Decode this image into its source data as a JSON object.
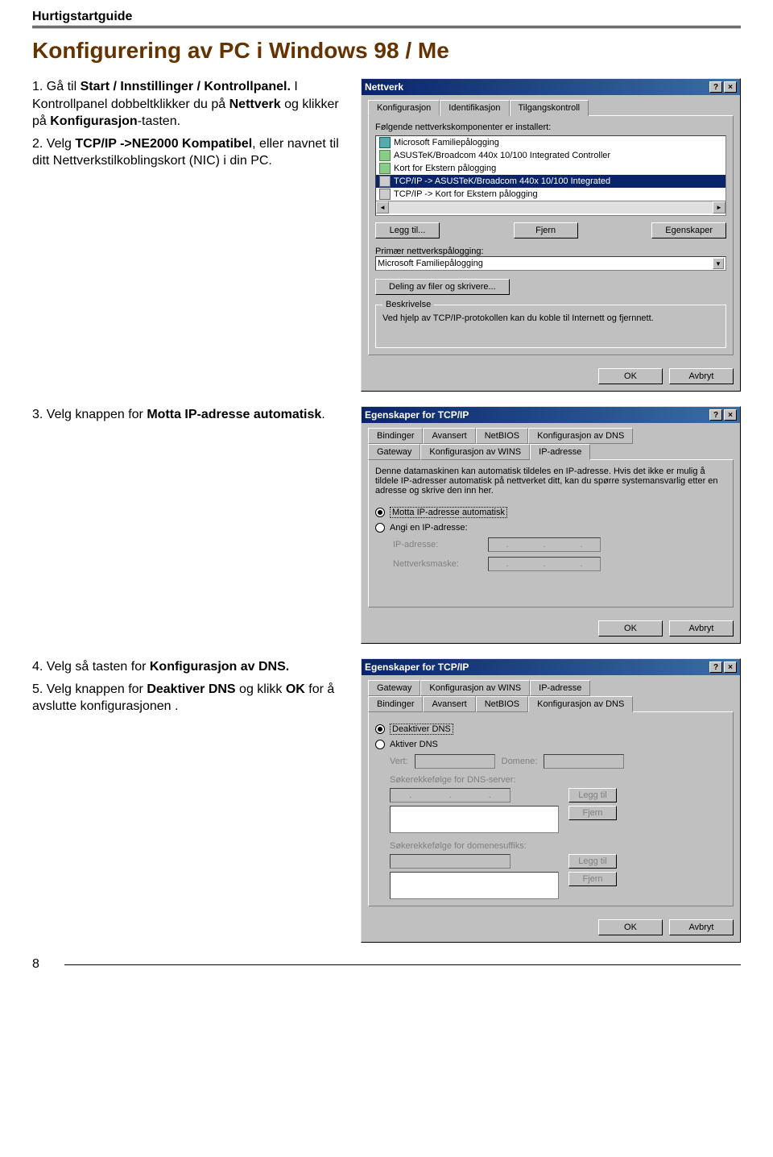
{
  "doc_header": "Hurtigstartguide",
  "page_title": "Konfigurering av PC i Windows 98 / Me",
  "steps": {
    "s1a_pre": "1. Gå til ",
    "s1a_b": "Start / Innstillinger / Kontrollpanel.",
    "s1b_pre": " I Kontrollpanel dobbeltklikker du på ",
    "s1b_b1": "Nettverk",
    "s1b_mid": " og klikker på ",
    "s1b_b2": "Konfigurasjon",
    "s1b_post": "-tasten.",
    "s2_pre": "2. Velg ",
    "s2_b": "TCP/IP ->NE2000 Kompatibel",
    "s2_post": ",    eller navnet til ditt Nettverkstilkoblingskort (NIC) i din PC.",
    "s3_pre": "3. Velg knappen for ",
    "s3_b": "Motta IP-adresse automatisk",
    "s3_post": ".",
    "s4_pre": "4. Velg så tasten for ",
    "s4_b": "Konfigurasjon av DNS.",
    "s5_pre": "5. Velg knappen for ",
    "s5_b": "Deaktiver DNS",
    "s5_mid": " og klikk ",
    "s5_b2": "OK",
    "s5_post": " for å avslutte konfigurasjonen .",
    "page_number": "8"
  },
  "win1": {
    "title": "Nettverk",
    "help": "?",
    "close": "×",
    "tabs": [
      "Konfigurasjon",
      "Identifikasjon",
      "Tilgangskontroll"
    ],
    "components_label": "Følgende nettverkskomponenter er installert:",
    "items": [
      "Microsoft Familiepålogging",
      "ASUSTeK/Broadcom 440x 10/100 Integrated Controller",
      "Kort for Ekstern pålogging",
      "TCP/IP -> ASUSTeK/Broadcom 440x 10/100 Integrated",
      "TCP/IP -> Kort for Ekstern pålogging"
    ],
    "btn_add": "Legg til...",
    "btn_remove": "Fjern",
    "btn_props": "Egenskaper",
    "primary_logon_label": "Primær nettverkspålogging:",
    "primary_logon_value": "Microsoft Familiepålogging",
    "btn_share": "Deling av filer og skrivere...",
    "desc_title": "Beskrivelse",
    "desc_text": "Ved hjelp av TCP/IP-protokollen kan du koble til Internett og fjernnett.",
    "ok": "OK",
    "cancel": "Avbryt"
  },
  "win2": {
    "title": "Egenskaper for TCP/IP",
    "tabs_row1": [
      "Bindinger",
      "Avansert",
      "NetBIOS",
      "Konfigurasjon av DNS"
    ],
    "tabs_row2": [
      "Gateway",
      "Konfigurasjon av WINS",
      "IP-adresse"
    ],
    "text": "Denne datamaskinen kan automatisk tildeles en IP-adresse. Hvis det ikke er mulig å tildele IP-adresser automatisk på nettverket ditt, kan du spørre systemansvarlig etter en adresse og skrive den inn her.",
    "radio_auto": "Motta IP-adresse automatisk",
    "radio_manual": "Angi en IP-adresse:",
    "lbl_ip": "IP-adresse:",
    "lbl_mask": "Nettverksmaske:",
    "ok": "OK",
    "cancel": "Avbryt"
  },
  "win3": {
    "title": "Egenskaper for TCP/IP",
    "tabs_row1": [
      "Gateway",
      "Konfigurasjon av WINS",
      "IP-adresse"
    ],
    "tabs_row2": [
      "Bindinger",
      "Avansert",
      "NetBIOS",
      "Konfigurasjon av DNS"
    ],
    "radio_off": "Deaktiver DNS",
    "radio_on": "Aktiver DNS",
    "lbl_host": "Vert:",
    "lbl_domain": "Domene:",
    "lbl_search_server": "Søkerekkefølge for DNS-server:",
    "lbl_search_suffix": "Søkerekkefølge for domenesuffiks:",
    "btn_add": "Legg til",
    "btn_remove": "Fjern",
    "ok": "OK",
    "cancel": "Avbryt"
  }
}
